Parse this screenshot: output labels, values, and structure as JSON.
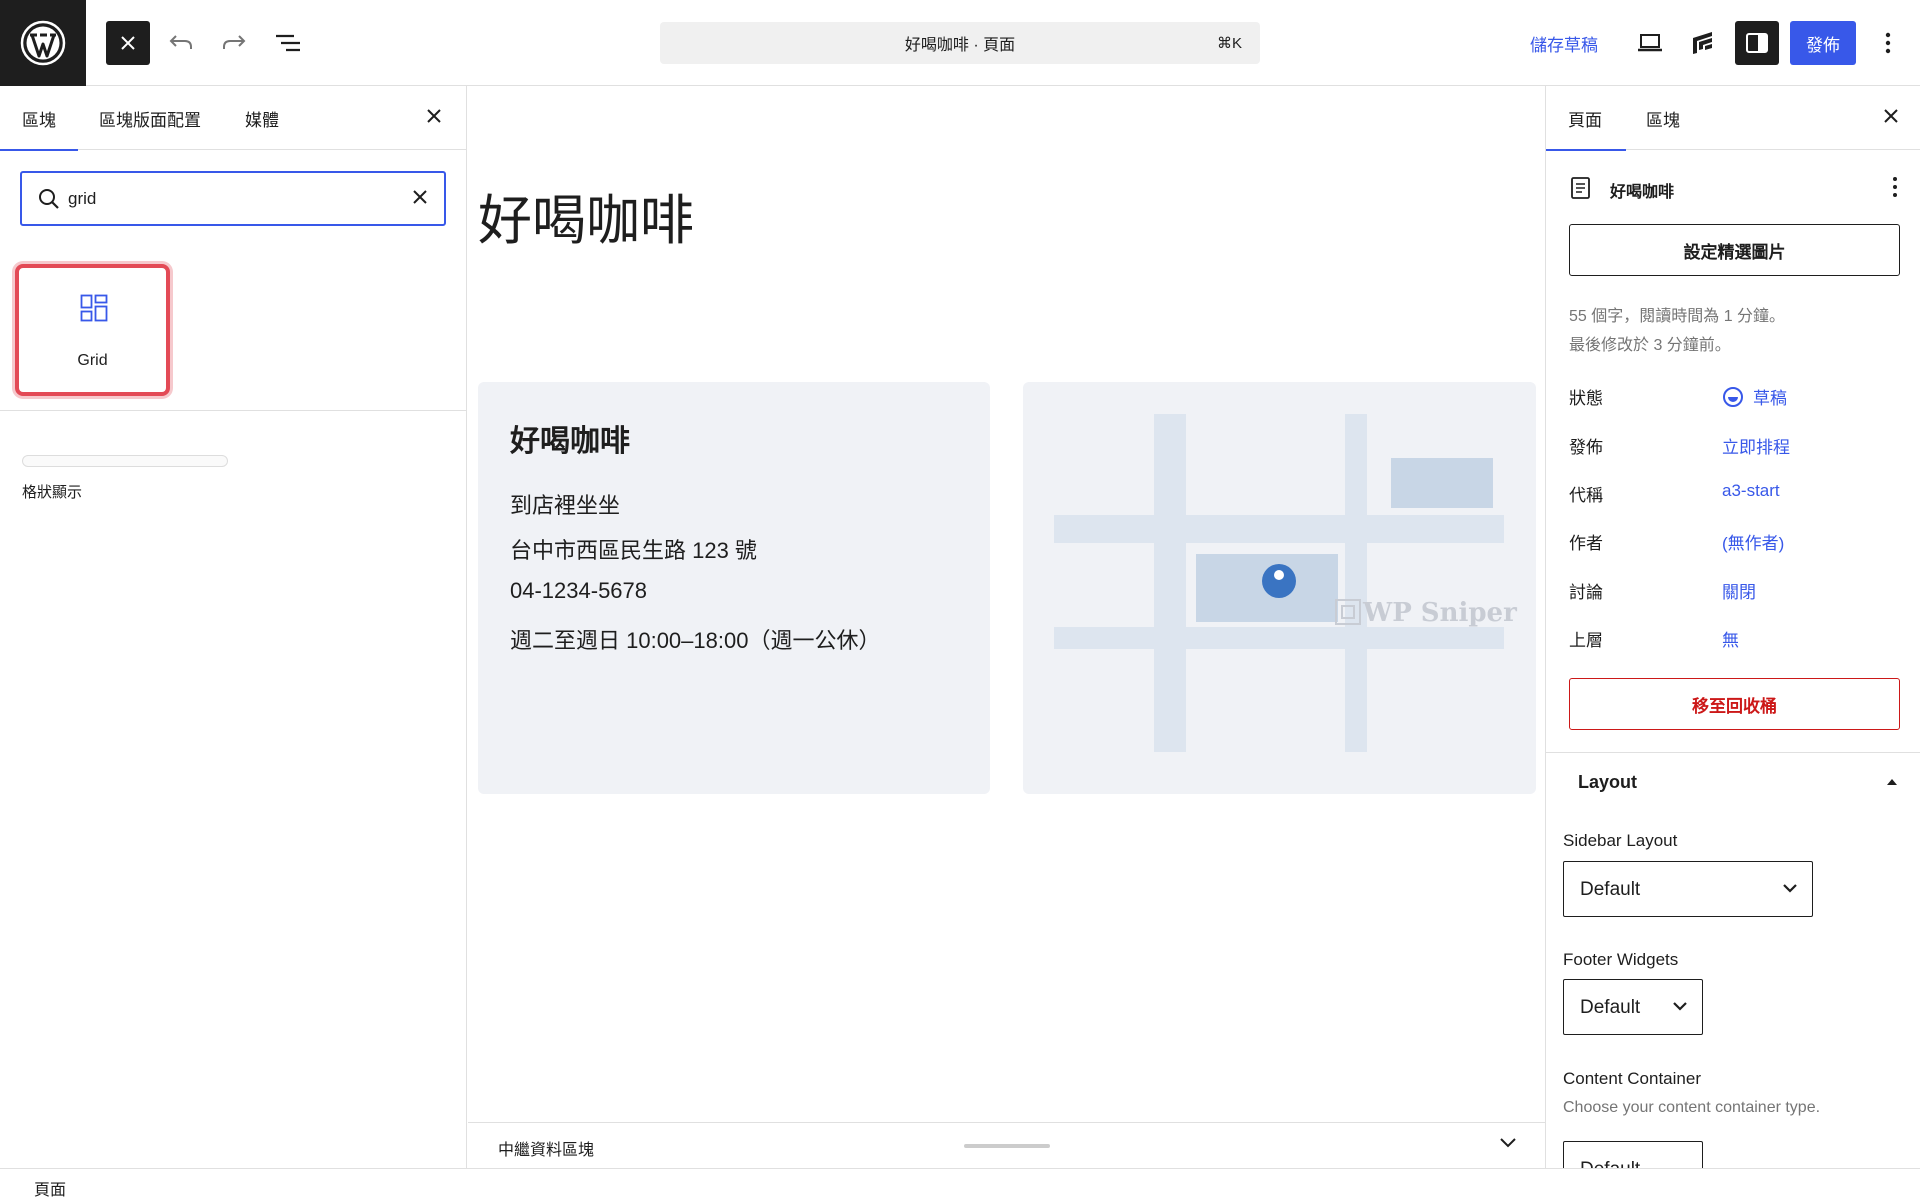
{
  "topbar": {
    "command_bar": "好喝咖啡 · 頁面",
    "shortcut": "⌘K",
    "save_draft": "儲存草稿",
    "publish": "發佈"
  },
  "inserter": {
    "tabs": [
      {
        "label": "區塊",
        "active": true
      },
      {
        "label": "區塊版面配置",
        "active": false
      },
      {
        "label": "媒體",
        "active": false
      }
    ],
    "search_value": "grid",
    "result_block": {
      "label": "Grid",
      "icon": "grid-block-icon"
    },
    "pattern_label": "格狀顯示"
  },
  "canvas": {
    "page_title": "好喝咖啡",
    "card": {
      "title": "好喝咖啡",
      "lines": [
        "到店裡坐坐",
        "台中市西區民生路 123 號",
        "04-1234-5678",
        "週二至週日 10:00–18:00（週一公休）"
      ]
    },
    "map_watermark": "WP Sniper",
    "meta_boxes_label": "中繼資料區塊"
  },
  "settings": {
    "tabs": [
      {
        "label": "頁面",
        "active": true
      },
      {
        "label": "區塊",
        "active": false
      }
    ],
    "document_title": "好喝咖啡",
    "featured_image_button": "設定精選圖片",
    "word_info": "55 個字，閱讀時間為 1 分鐘。",
    "modified_info": "最後修改於 3 分鐘前。",
    "rows": [
      {
        "key": "狀態",
        "value": "草稿"
      },
      {
        "key": "發佈",
        "value": "立即排程"
      },
      {
        "key": "代稱",
        "value": "a3-start"
      },
      {
        "key": "作者",
        "value": "(無作者)"
      },
      {
        "key": "討論",
        "value": "關閉"
      },
      {
        "key": "上層",
        "value": "無"
      }
    ],
    "trash_button": "移至回收桶",
    "layout": {
      "heading": "Layout",
      "sidebar_layout_label": "Sidebar Layout",
      "sidebar_layout_value": "Default",
      "footer_widgets_label": "Footer Widgets",
      "footer_widgets_value": "Default",
      "content_container_label": "Content Container",
      "content_container_help": "Choose your content container type.",
      "content_container_value": "Default"
    }
  },
  "breadcrumb": "頁面",
  "colors": {
    "accent": "#3858e9",
    "danger": "#cc1818",
    "highlight": "#e34a56",
    "card_bg": "#f0f2f6",
    "map_road": "#dde5ef",
    "map_block": "#c8d6e6",
    "map_pin": "#3a74c2"
  }
}
